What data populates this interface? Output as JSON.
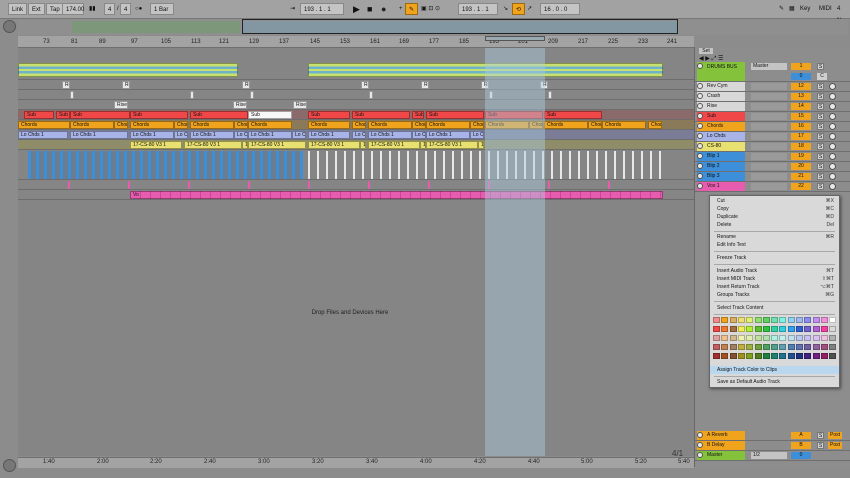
{
  "topbar": {
    "link": "Link",
    "ext": "Ext",
    "tap": "Tap",
    "tempo": "174.00",
    "sig_num": "4",
    "sig_den": "4",
    "quant": "1 Bar",
    "position": "193 . 1 . 1",
    "loop_start": "193 . 1 . 1",
    "loop_len": "16 . 0 . 0",
    "key": "Key",
    "midi": "MIDI",
    "cpu": "4 %"
  },
  "ruler": [
    "73",
    "81",
    "89",
    "97",
    "105",
    "113",
    "121",
    "129",
    "137",
    "145",
    "153",
    "161",
    "169",
    "177",
    "185",
    "193",
    "201",
    "209",
    "217",
    "225",
    "233",
    "241"
  ],
  "bottom_ruler": [
    "1:40",
    "2:00",
    "2:20",
    "2:40",
    "3:00",
    "3:20",
    "3:40",
    "4:00",
    "4:20",
    "4:40",
    "5:00",
    "5:20",
    "5:40"
  ],
  "page_fraction": "4/1",
  "drop_hint": "Drop Files and Devices Here",
  "set_label": "Set",
  "tracks": [
    {
      "name": "DRUMS BUS",
      "num": "1",
      "color": "#84c23c",
      "sends": "",
      "tall": true
    },
    {
      "name": "Rev Cym",
      "num": "12",
      "color": "#d8d8d8"
    },
    {
      "name": "Crash",
      "num": "13",
      "color": "#d8d8d8"
    },
    {
      "name": "Rise",
      "num": "14",
      "color": "#d8d8d8"
    },
    {
      "name": "Sub",
      "num": "15",
      "color": "#f04848"
    },
    {
      "name": "Chords",
      "num": "16",
      "color": "#f0a31c"
    },
    {
      "name": "Lo Chds",
      "num": "17",
      "color": "#a8b4e8"
    },
    {
      "name": "CS-80",
      "num": "18",
      "color": "#e8e070"
    },
    {
      "name": "Blip 1",
      "num": "19",
      "color": "#3c8fd8"
    },
    {
      "name": "Blip 2",
      "num": "20",
      "color": "#3c8fd8"
    },
    {
      "name": "Blip 3",
      "num": "21",
      "color": "#3c8fd8"
    },
    {
      "name": "Vox 1",
      "num": "22",
      "color": "#e85cb0"
    }
  ],
  "master_label": "Master",
  "master_num": "1",
  "returns": [
    {
      "name": "A Reverb",
      "letter": "A",
      "post": "Post",
      "color": "#f0a31c"
    },
    {
      "name": "B Delay",
      "letter": "B",
      "post": "Post",
      "color": "#f0a31c"
    },
    {
      "name": "Master",
      "letter": "0",
      "post": "",
      "color": "#84c23c",
      "routing": "1/2"
    }
  ],
  "clips": {
    "sub": "Sub",
    "chords": "Chords",
    "chrd": "Chor",
    "lochds": "Lo Chds 1",
    "lochd": "Lo Ch",
    "cs80": "17-CS-80 V3 1",
    "cs": "17",
    "rise": "Rise",
    "re": "Re",
    "vox": "Vo"
  },
  "context_menu": {
    "cut": "Cut",
    "cut_sc": "⌘X",
    "copy": "Copy",
    "copy_sc": "⌘C",
    "duplicate": "Duplicate",
    "duplicate_sc": "⌘D",
    "delete": "Delete",
    "delete_sc": "Del",
    "rename": "Rename",
    "rename_sc": "⌘R",
    "edit_info": "Edit Info Text",
    "freeze": "Freeze Track",
    "insert_audio": "Insert Audio Track",
    "insert_audio_sc": "⌘T",
    "insert_midi": "Insert MIDI Track",
    "insert_midi_sc": "⇧⌘T",
    "insert_return": "Insert Return Track",
    "insert_return_sc": "⌥⌘T",
    "group": "Groups Tracks",
    "group_sc": "⌘G",
    "select_content": "Select Track Content",
    "assign_color": "Assign Track Color to Clips",
    "save_default": "Save as Default Audio Track"
  },
  "palette": [
    "#f08c8c",
    "#f0a31c",
    "#d8b060",
    "#f0e070",
    "#e0f070",
    "#90e070",
    "#60d060",
    "#70e0b0",
    "#80f0e0",
    "#90d0f0",
    "#a0b8f0",
    "#8c8cf0",
    "#c090f0",
    "#f090d8",
    "#ffffff",
    "#f04848",
    "#f07830",
    "#a07040",
    "#f0f050",
    "#b0f030",
    "#60c030",
    "#30c040",
    "#30d0a0",
    "#30d0e0",
    "#30a0f0",
    "#3060d0",
    "#7060d0",
    "#b060d0",
    "#f040a0",
    "#d8d8d8",
    "#e0a0a0",
    "#f0c090",
    "#d0b890",
    "#f0f0b0",
    "#e0f0b0",
    "#c0e0a0",
    "#b0e0b0",
    "#b0f0e0",
    "#c0f0f0",
    "#c0e0f0",
    "#b8c8f0",
    "#c8c0f0",
    "#d8c0f0",
    "#f0c0e0",
    "#b0b0b0",
    "#c06060",
    "#c08050",
    "#a08060",
    "#c0b040",
    "#a0b040",
    "#70a040",
    "#50a060",
    "#50a090",
    "#60a0b0",
    "#5080b0",
    "#6070b0",
    "#7060a0",
    "#9060a0",
    "#a05080",
    "#808080",
    "#a03030",
    "#a05020",
    "#805030",
    "#a09020",
    "#80a020",
    "#508020",
    "#208040",
    "#208070",
    "#207090",
    "#205090",
    "#203080",
    "#402080",
    "#702080",
    "#902060",
    "#505050"
  ]
}
